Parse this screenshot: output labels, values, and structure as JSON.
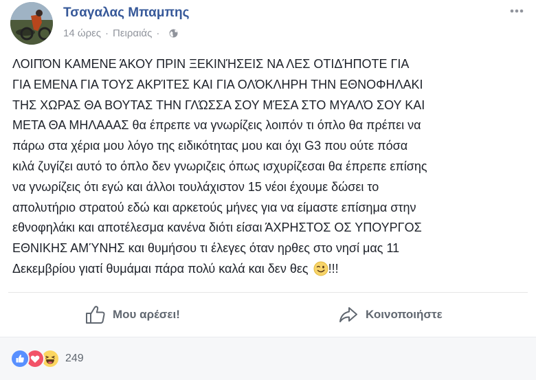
{
  "post": {
    "author": "Τσαγαλας Μπαμπης",
    "time": "14 ώρες",
    "separator": "·",
    "location": "Πειραιάς",
    "text_lines": [
      "ΛΟΙΠΌΝ ΚΑΜΕΝΕ ΆΚΟΥ ΠΡΙΝ ΞΕΚΙΝΉΣΕΙΣ ΝΑ ΛΕΣ ΟΤΙΔΉΠΟΤΕ ΓΙΑ",
      "ΓΙΑ ΕΜΕΝΑ ΓΙΑ ΤΟΥΣ ΑΚΡΊΤΕΣ ΚΑΙ ΓΙΑ ΟΛΌΚΛΗΡΗ ΤΗΝ ΕΘΝΟΦΗΛΑΚΙ",
      "ΤΗΣ ΧΩΡΑΣ ΘΑ ΒΟΥΤΑΣ ΤΗΝ ΓΛΏΣΣΑ ΣΟΥ ΜΈΣΑ ΣΤΟ ΜΥΑΛΌ ΣΟΥ ΚΑΙ",
      "ΜΕΤΑ ΘΑ ΜΗΛΑΑΑΣ θα έπρεπε να γνωρίζεις λοιπόν τι όπλο θα πρέπει να",
      "πάρω στα χέρια μου λόγο της ειδικότητας μου και όχι G3 που ούτε πόσα",
      "κιλά ζυγίζει αυτό το όπλο δεν γνωριζεις όπως ισχυρίζεσαι θα έπρεπε επίσης",
      "να γνωρίζεις ότι εγώ και άλλοι τουλάχιστον 15 νέοι έχουμε δώσει το",
      "απολυτήριο στρατού εδώ και αρκετούς μήνες για να είμαστε επίσημα στην",
      "εθνοφηλάκι και αποτέλεσμα κανένα διότι είσαι ΆΧΡΗΣΤΟΣ ΟΣ ΥΠΟΥΡΓΟΣ",
      "ΕΘΝΙΚΗΣ ΑΜΎΝΗΣ και θυμήσου τι έλεγες όταν ηρθες στο νησί μας 11"
    ],
    "last_line_text": "Δεκεμβρίου γιατί θυμάμαι πάρα πολύ καλά και δεν θες",
    "last_line_suffix": "!!!",
    "emoji_icon": "wink-emoji-icon"
  },
  "actions": {
    "like_label": "Μου αρέσει!",
    "share_label": "Κοινοποιήστε"
  },
  "reactions": {
    "icons": [
      "like-reaction-icon",
      "love-reaction-icon",
      "haha-reaction-icon"
    ],
    "count": "249"
  },
  "colors": {
    "author": "#365899",
    "meta": "#90949c",
    "action": "#606770",
    "like_blue": "#5890ff",
    "love_red": "#f25268",
    "haha_yellow": "#fcd660"
  }
}
